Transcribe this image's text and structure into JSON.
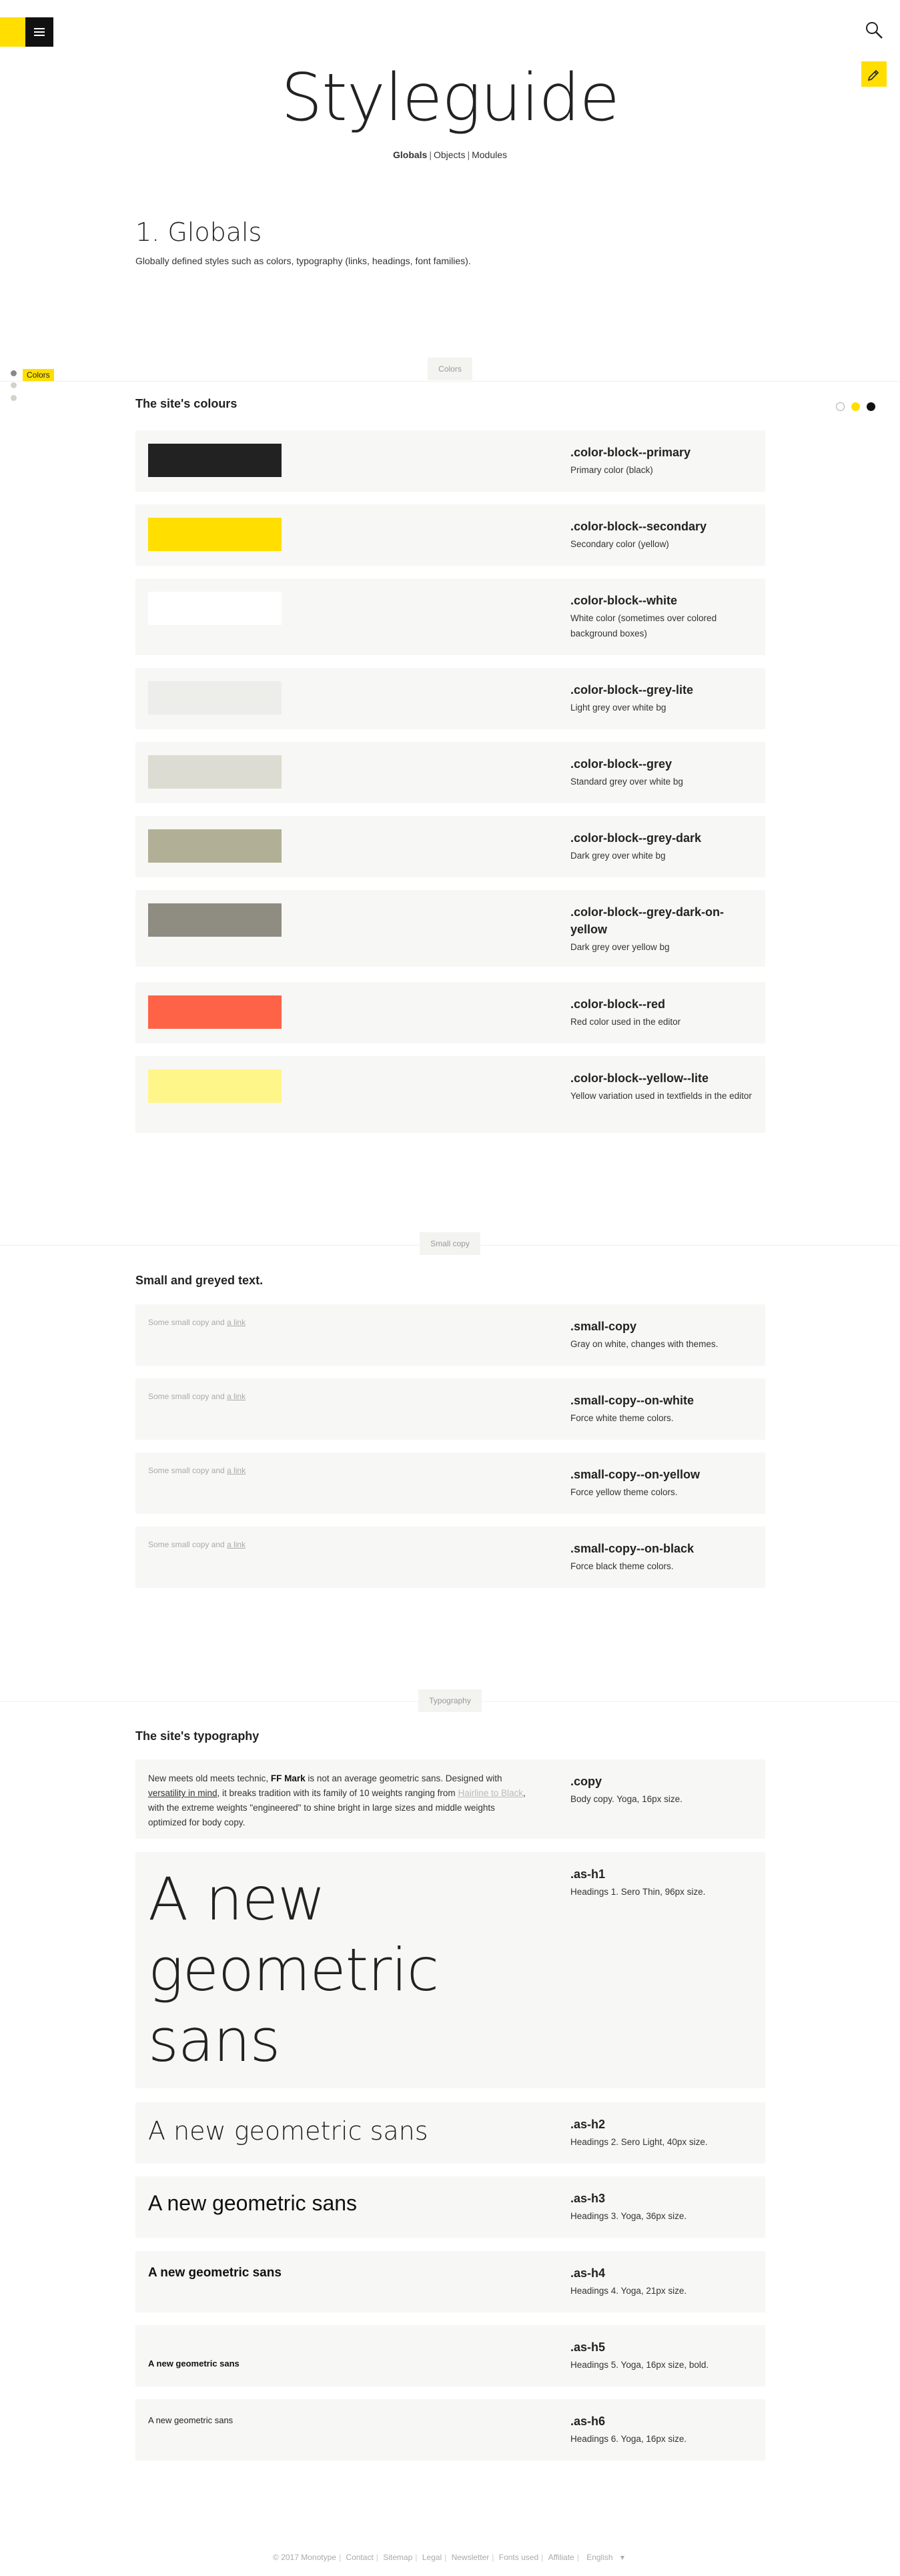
{
  "header": {
    "menu_icon": "hamburger-icon",
    "search_icon": "search-icon",
    "edit_icon": "pencil-icon"
  },
  "title": "Styleguide",
  "subnav": {
    "globals": "Globals",
    "objects": "Objects",
    "modules": "Modules",
    "sep": "|"
  },
  "section": {
    "heading": "1. Globals",
    "intro": "Globally defined styles such as colors, typography (links, headings, font families)."
  },
  "sidenav": {
    "active_label": "Colors"
  },
  "themes": [
    {
      "name": "white",
      "color": "#ffffff"
    },
    {
      "name": "yellow",
      "color": "#ffde00"
    },
    {
      "name": "black",
      "color": "#111111"
    }
  ],
  "colors_group": {
    "tag": "Colors",
    "heading": "The site's colours",
    "items": [
      {
        "cls": ".color-block--primary",
        "desc": "Primary color (black)",
        "color": "#222222"
      },
      {
        "cls": ".color-block--secondary",
        "desc": "Secondary color (yellow)",
        "color": "#ffde00"
      },
      {
        "cls": ".color-block--white",
        "desc": "White color (sometimes over colored background boxes)",
        "color": "#ffffff"
      },
      {
        "cls": ".color-block--grey-lite",
        "desc": "Light grey over white bg",
        "color": "#ededea"
      },
      {
        "cls": ".color-block--grey",
        "desc": "Standard grey over white bg",
        "color": "#dcdcd2"
      },
      {
        "cls": ".color-block--grey-dark",
        "desc": "Dark grey over white bg",
        "color": "#b1b096"
      },
      {
        "cls": ".color-block--grey-dark-on-yellow",
        "desc": "Dark grey over yellow bg",
        "color": "#8f8d82"
      },
      {
        "cls": ".color-block--red",
        "desc": "Red color used in the editor",
        "color": "#ff6347"
      },
      {
        "cls": ".color-block--yellow--lite",
        "desc": "Yellow variation used in textfields in the editor",
        "color": "#fff68a"
      }
    ]
  },
  "small_group": {
    "tag": "Small copy",
    "heading": "Small and greyed text.",
    "sample_text": "Some small copy and",
    "sample_link": "a link",
    "items": [
      {
        "cls": ".small-copy",
        "desc": "Gray on white, changes with themes."
      },
      {
        "cls": ".small-copy--on-white",
        "desc": "Force white theme colors."
      },
      {
        "cls": ".small-copy--on-yellow",
        "desc": "Force yellow theme colors."
      },
      {
        "cls": ".small-copy--on-black",
        "desc": "Force black theme colors."
      }
    ]
  },
  "type_group": {
    "tag": "Typography",
    "heading": "The site's typography",
    "copy": {
      "t1": "New meets old meets technic,",
      "bold": "FF Mark",
      "t2": "is not an average geometric sans. Designed with",
      "link1": "versatility in mind",
      "t3": ", it breaks tradition with its family of 10 weights ranging from",
      "link2": "Hairline to Black",
      "t4": ", with the extreme weights \"engineered\" to shine bright in large sizes and middle weights optimized for body copy.",
      "cls": ".copy",
      "desc": "Body copy. Yoga, 16px size."
    },
    "sample": "A new geometric sans",
    "h1": {
      "cls": ".as-h1",
      "desc": "Headings 1. Sero Thin, 96px size."
    },
    "h2": {
      "cls": ".as-h2",
      "desc": "Headings 2. Sero Light, 40px size."
    },
    "h3": {
      "cls": ".as-h3",
      "desc": "Headings 3. Yoga, 36px size."
    },
    "h4": {
      "cls": ".as-h4",
      "desc": "Headings 4. Yoga, 21px size."
    },
    "h5": {
      "cls": ".as-h5",
      "desc": "Headings 5. Yoga, 16px size, bold."
    },
    "h6": {
      "cls": ".as-h6",
      "desc": "Headings 6. Yoga, 16px size."
    }
  },
  "footer": {
    "copyright": "© 2017 Monotype",
    "contact": "Contact",
    "sitemap": "Sitemap",
    "legal": "Legal",
    "newsletter": "Newsletter",
    "fonts_used": "Fonts used",
    "affiliate": "Affiliate",
    "language": "English",
    "sep": "|",
    "caret": "▾"
  }
}
